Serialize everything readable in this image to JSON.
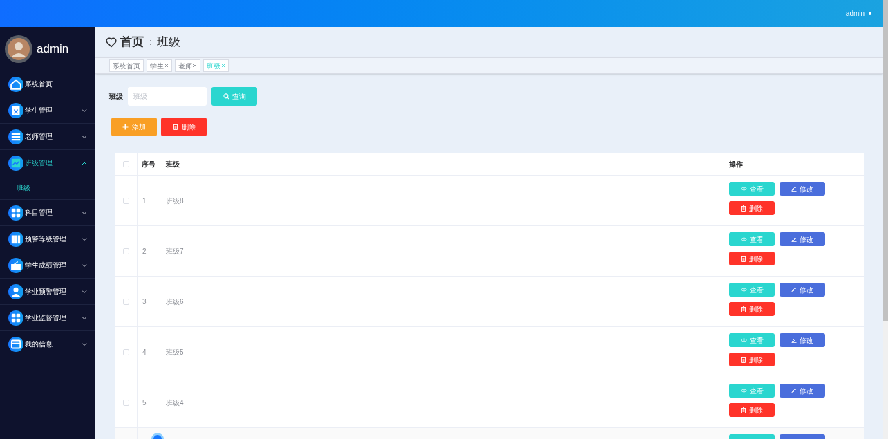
{
  "topbar": {
    "user": "admin",
    "caret": "▼"
  },
  "sidebar": {
    "user": "admin",
    "items": [
      {
        "label": "系统首页",
        "kind": "home",
        "selected": false
      },
      {
        "label": "学生管理",
        "kind": "clipboard",
        "expanded": false,
        "selected": false
      },
      {
        "label": "老师管理",
        "kind": "list",
        "expanded": false,
        "selected": false
      },
      {
        "label": "班级管理",
        "kind": "chart",
        "expanded": true,
        "selected": true,
        "children": [
          {
            "label": "班级",
            "selected": true
          }
        ]
      },
      {
        "label": "科目管理",
        "kind": "grid",
        "expanded": false,
        "selected": false
      },
      {
        "label": "预警等级管理",
        "kind": "book",
        "expanded": false,
        "selected": false
      },
      {
        "label": "学生成绩管理",
        "kind": "wallet",
        "expanded": false,
        "selected": false
      },
      {
        "label": "学业预警管理",
        "kind": "person",
        "expanded": false,
        "selected": false
      },
      {
        "label": "学业监督管理",
        "kind": "grid",
        "expanded": false,
        "selected": false
      },
      {
        "label": "我的信息",
        "kind": "card",
        "expanded": false,
        "selected": false
      }
    ]
  },
  "breadcrumb": {
    "home": "首页",
    "separator": ":",
    "current": "班级"
  },
  "tabs": [
    {
      "label": "系统首页",
      "closable": false,
      "selected": false
    },
    {
      "label": "学生",
      "closable": true,
      "selected": false
    },
    {
      "label": "老师",
      "closable": true,
      "selected": false
    },
    {
      "label": "班级",
      "closable": true,
      "selected": true
    }
  ],
  "search": {
    "label": "班级",
    "placeholder": "班级",
    "button": "查询"
  },
  "actions": [
    {
      "label": "添加",
      "kind": "add"
    },
    {
      "label": "删除",
      "kind": "delete"
    }
  ],
  "table": {
    "columns": [
      "序号",
      "班级",
      "操作"
    ],
    "all_checked": false,
    "rows": [
      {
        "index": "1",
        "name": "班级8",
        "checked": false,
        "buttons": [
          {
            "label": "查看",
            "kind": "view"
          },
          {
            "label": "修改",
            "kind": "edit"
          },
          {
            "label": "删除",
            "kind": "delete"
          }
        ]
      },
      {
        "index": "2",
        "name": "班级7",
        "checked": false,
        "buttons": [
          {
            "label": "查看",
            "kind": "view"
          },
          {
            "label": "修改",
            "kind": "edit"
          },
          {
            "label": "删除",
            "kind": "delete"
          }
        ]
      },
      {
        "index": "3",
        "name": "班级6",
        "checked": false,
        "buttons": [
          {
            "label": "查看",
            "kind": "view"
          },
          {
            "label": "修改",
            "kind": "edit"
          },
          {
            "label": "删除",
            "kind": "delete"
          }
        ]
      },
      {
        "index": "4",
        "name": "班级5",
        "checked": false,
        "buttons": [
          {
            "label": "查看",
            "kind": "view"
          },
          {
            "label": "修改",
            "kind": "edit"
          },
          {
            "label": "删除",
            "kind": "delete"
          }
        ]
      },
      {
        "index": "5",
        "name": "班级4",
        "checked": false,
        "buttons": [
          {
            "label": "查看",
            "kind": "view"
          },
          {
            "label": "修改",
            "kind": "edit"
          },
          {
            "label": "删除",
            "kind": "delete"
          }
        ]
      }
    ]
  }
}
